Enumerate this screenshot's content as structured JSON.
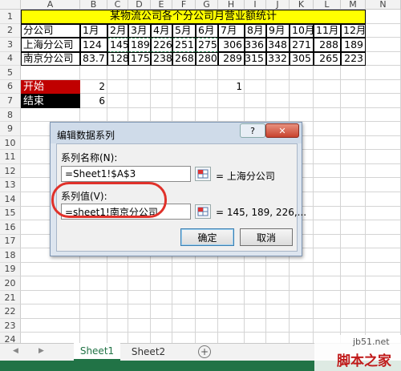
{
  "columns": [
    "A",
    "B",
    "C",
    "D",
    "E",
    "F",
    "G",
    "H",
    "I",
    "J",
    "K",
    "L",
    "M",
    "N"
  ],
  "rows": [
    "1",
    "2",
    "3",
    "4",
    "5",
    "6",
    "7",
    "8",
    "9",
    "10",
    "11",
    "12",
    "13",
    "14",
    "15",
    "16",
    "17",
    "18",
    "19",
    "20",
    "21",
    "22",
    "23",
    "24"
  ],
  "sheet": {
    "title": "某物流公司各个分公司月营业额统计",
    "header_row": [
      "分公司",
      "1月",
      "2月",
      "3月",
      "4月",
      "5月",
      "6月",
      "7月",
      "8月",
      "9月",
      "10月",
      "11月",
      "12月"
    ],
    "data_rows": [
      [
        "上海分公司",
        "124",
        "145",
        "189",
        "226",
        "251",
        "275",
        "306",
        "336",
        "348",
        "271",
        "288",
        "189"
      ],
      [
        "南京分公司",
        "83.7",
        "128",
        "175",
        "238",
        "268",
        "280",
        "289",
        "315",
        "332",
        "305",
        "265",
        "223"
      ]
    ],
    "start_label": "开始",
    "start_value": "2",
    "start_h6": "1",
    "end_label": "结束",
    "end_value": "6",
    "start_color": "#c00000",
    "end_color": "#000000",
    "title_fill": "#ffff00"
  },
  "dialog": {
    "title": "编辑数据系列",
    "help": "?",
    "close": "✕",
    "series_name_label": "系列名称(N):",
    "series_name_value": "=Sheet1!$A$3",
    "series_name_preview": "= 上海分公司",
    "series_values_label": "系列值(V):",
    "series_values_value": "=sheet1!南京分公司",
    "series_values_preview": "= 145, 189, 226,...",
    "ok": "确定",
    "cancel": "取消",
    "highlight_color": "#e0312a"
  },
  "tabs": {
    "nav_left": "◀",
    "nav_right": "▶",
    "sheet1": "Sheet1",
    "sheet2": "Sheet2",
    "add": "+"
  },
  "watermark": {
    "site": "jb51.net",
    "brand": "脚本之家"
  }
}
